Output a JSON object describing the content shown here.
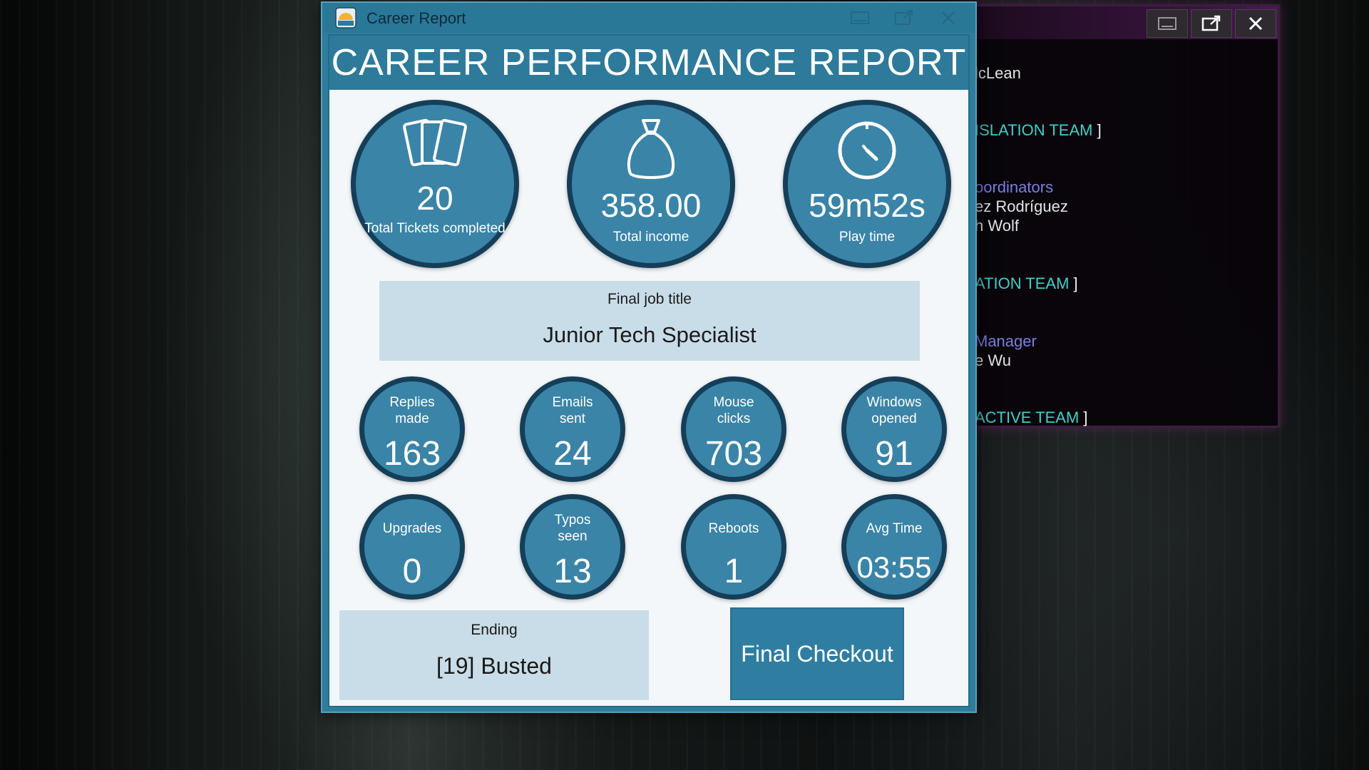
{
  "credits_window": {
    "lines": [
      {
        "text": "lcLean",
        "style": "white"
      },
      {
        "text": "ISLATION TEAM",
        "style": "team",
        "bracket": "]"
      },
      {
        "text": "oordinators",
        "style": "role"
      },
      {
        "text": "ez Rodríguez",
        "style": "white"
      },
      {
        "text": "h Wolf",
        "style": "white"
      },
      {
        "text": "ATION TEAM",
        "style": "team",
        "bracket": "]"
      },
      {
        "text": "Manager",
        "style": "role"
      },
      {
        "text": "e Wu",
        "style": "white"
      },
      {
        "text": "ACTIVE TEAM",
        "style": "team",
        "bracket": "]"
      }
    ]
  },
  "report_window": {
    "title": "Career Report",
    "header": "CAREER PERFORMANCE REPORT",
    "top_stats": [
      {
        "icon": "cards-icon",
        "value": "20",
        "label": "Total Tickets completed"
      },
      {
        "icon": "money-bag-icon",
        "value": "358.00",
        "label": "Total income"
      },
      {
        "icon": "clock-icon",
        "value": "59m52s",
        "label": "Play time"
      }
    ],
    "job": {
      "label": "Final job title",
      "value": "Junior Tech Specialist"
    },
    "stats_row1": [
      {
        "label": "Replies made",
        "value": "163"
      },
      {
        "label": "Emails sent",
        "value": "24"
      },
      {
        "label": "Mouse clicks",
        "value": "703"
      },
      {
        "label": "Windows opened",
        "value": "91"
      }
    ],
    "stats_row2": [
      {
        "label": "Upgrades",
        "value": "0"
      },
      {
        "label": "Typos seen",
        "value": "13"
      },
      {
        "label": "Reboots",
        "value": "1"
      },
      {
        "label": "Avg Time",
        "value": "03:55"
      }
    ],
    "ending": {
      "label": "Ending",
      "value": "[19] Busted"
    },
    "checkout_label": "Final Checkout"
  },
  "colors": {
    "accent": "#2d7a9b",
    "circle_fill": "#3a84a8",
    "circle_border": "#153e58",
    "panel": "#c9dde8",
    "credits_team": "#3fd0c8",
    "credits_role": "#7a7ee0"
  }
}
